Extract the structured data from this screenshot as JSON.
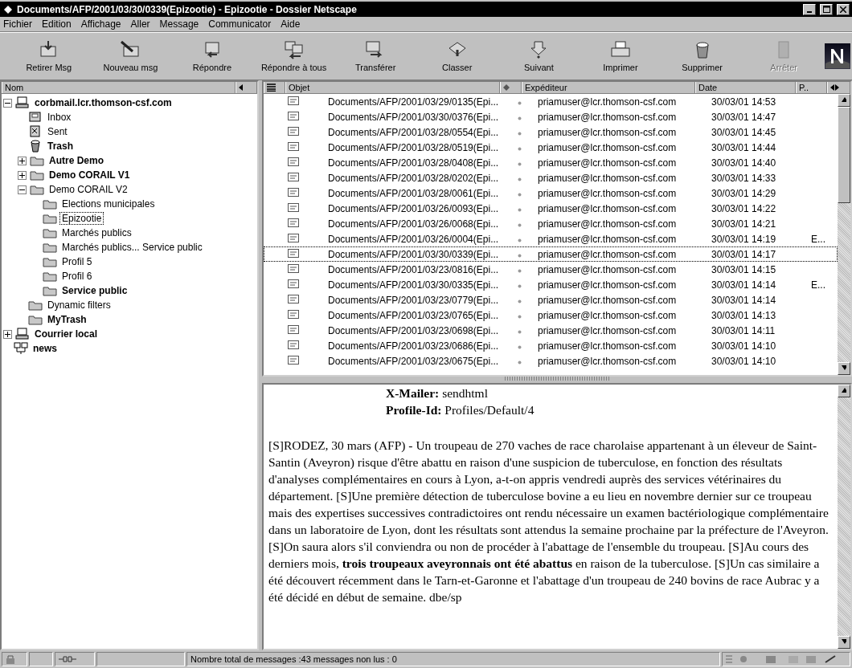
{
  "window": {
    "title": "Documents/AFP/2001/03/30/0339(Epizootie) - Epizootie - Dossier Netscape"
  },
  "menu": [
    {
      "label": "Fichier"
    },
    {
      "label": "Edition"
    },
    {
      "label": "Affichage"
    },
    {
      "label": "Aller"
    },
    {
      "label": "Message"
    },
    {
      "label": "Communicator"
    },
    {
      "label": "Aide"
    }
  ],
  "toolbar": [
    {
      "label": "Retirer Msg",
      "kind": "get",
      "disabled": false
    },
    {
      "label": "Nouveau msg",
      "kind": "new",
      "disabled": false
    },
    {
      "label": "Répondre",
      "kind": "reply",
      "disabled": false
    },
    {
      "label": "Répondre à tous",
      "kind": "replyall",
      "disabled": false
    },
    {
      "label": "Transférer",
      "kind": "forward",
      "disabled": false
    },
    {
      "label": "Classer",
      "kind": "file",
      "disabled": false
    },
    {
      "label": "Suivant",
      "kind": "next",
      "disabled": false
    },
    {
      "label": "Imprimer",
      "kind": "print",
      "disabled": false
    },
    {
      "label": "Supprimer",
      "kind": "delete",
      "disabled": false
    },
    {
      "label": "Arrêter",
      "kind": "stop",
      "disabled": true
    }
  ],
  "folder_pane": {
    "header": "Nom",
    "tree": [
      {
        "label": "corbmail.lcr.thomson-csf.com",
        "kind": "server",
        "bold": true,
        "selected": false,
        "expanded": true,
        "children": [
          {
            "label": "Inbox",
            "kind": "inbox",
            "bold": false,
            "selected": false
          },
          {
            "label": "Sent",
            "kind": "sent",
            "bold": false,
            "selected": false
          },
          {
            "label": "Trash",
            "kind": "trash",
            "bold": true,
            "selected": false
          },
          {
            "label": "Autre Demo",
            "kind": "folder",
            "bold": true,
            "selected": false,
            "expanded": false
          },
          {
            "label": "Demo CORAIL V1",
            "kind": "folder",
            "bold": true,
            "selected": false,
            "expanded": false
          },
          {
            "label": "Demo CORAIL V2",
            "kind": "folder",
            "bold": false,
            "selected": false,
            "expanded": true,
            "children": [
              {
                "label": "Elections municipales",
                "kind": "folder",
                "bold": false,
                "selected": false
              },
              {
                "label": "Epizootie",
                "kind": "folder",
                "bold": false,
                "selected": true
              },
              {
                "label": "Marchés publics",
                "kind": "folder",
                "bold": false,
                "selected": false
              },
              {
                "label": "Marchés publics... Service public",
                "kind": "folder",
                "bold": false,
                "selected": false
              },
              {
                "label": "Profil 5",
                "kind": "folder",
                "bold": false,
                "selected": false
              },
              {
                "label": "Profil 6",
                "kind": "folder",
                "bold": false,
                "selected": false
              },
              {
                "label": "Service public",
                "kind": "folder",
                "bold": true,
                "selected": false
              }
            ]
          },
          {
            "label": "Dynamic filters",
            "kind": "folder",
            "bold": false,
            "selected": false
          },
          {
            "label": "MyTrash",
            "kind": "folder",
            "bold": true,
            "selected": false
          }
        ]
      },
      {
        "label": "Courrier local",
        "kind": "server",
        "bold": true,
        "selected": false,
        "expanded": false
      },
      {
        "label": "news",
        "kind": "news",
        "bold": true,
        "selected": false
      }
    ]
  },
  "message_list": {
    "columns": [
      "Objet",
      "Expéditeur",
      "Date",
      "P.."
    ],
    "rows": [
      {
        "subject": "Documents/AFP/2001/03/29/0135(Epi...",
        "sender": "priamuser@lcr.thomson-csf.com",
        "date": "30/03/01 14:53",
        "selected": false
      },
      {
        "subject": "Documents/AFP/2001/03/30/0376(Epi...",
        "sender": "priamuser@lcr.thomson-csf.com",
        "date": "30/03/01 14:47",
        "selected": false
      },
      {
        "subject": "Documents/AFP/2001/03/28/0554(Epi...",
        "sender": "priamuser@lcr.thomson-csf.com",
        "date": "30/03/01 14:45",
        "selected": false
      },
      {
        "subject": "Documents/AFP/2001/03/28/0519(Epi...",
        "sender": "priamuser@lcr.thomson-csf.com",
        "date": "30/03/01 14:44",
        "selected": false
      },
      {
        "subject": "Documents/AFP/2001/03/28/0408(Epi...",
        "sender": "priamuser@lcr.thomson-csf.com",
        "date": "30/03/01 14:40",
        "selected": false
      },
      {
        "subject": "Documents/AFP/2001/03/28/0202(Epi...",
        "sender": "priamuser@lcr.thomson-csf.com",
        "date": "30/03/01 14:33",
        "selected": false
      },
      {
        "subject": "Documents/AFP/2001/03/28/0061(Epi...",
        "sender": "priamuser@lcr.thomson-csf.com",
        "date": "30/03/01 14:29",
        "selected": false
      },
      {
        "subject": "Documents/AFP/2001/03/26/0093(Epi...",
        "sender": "priamuser@lcr.thomson-csf.com",
        "date": "30/03/01 14:22",
        "selected": false
      },
      {
        "subject": "Documents/AFP/2001/03/26/0068(Epi...",
        "sender": "priamuser@lcr.thomson-csf.com",
        "date": "30/03/01 14:21",
        "selected": false
      },
      {
        "subject": "Documents/AFP/2001/03/26/0004(Epi...",
        "sender": "priamuser@lcr.thomson-csf.com",
        "date": "30/03/01 14:19",
        "column_5": "E...",
        "selected": false
      },
      {
        "subject": "Documents/AFP/2001/03/30/0339(Epi...",
        "sender": "priamuser@lcr.thomson-csf.com",
        "date": "30/03/01 14:17",
        "selected": true
      },
      {
        "subject": "Documents/AFP/2001/03/23/0816(Epi...",
        "sender": "priamuser@lcr.thomson-csf.com",
        "date": "30/03/01 14:15",
        "selected": false
      },
      {
        "subject": "Documents/AFP/2001/03/30/0335(Epi...",
        "sender": "priamuser@lcr.thomson-csf.com",
        "date": "30/03/01 14:14",
        "column_5": "E...",
        "selected": false
      },
      {
        "subject": "Documents/AFP/2001/03/23/0779(Epi...",
        "sender": "priamuser@lcr.thomson-csf.com",
        "date": "30/03/01 14:14",
        "selected": false
      },
      {
        "subject": "Documents/AFP/2001/03/23/0765(Epi...",
        "sender": "priamuser@lcr.thomson-csf.com",
        "date": "30/03/01 14:13",
        "selected": false
      },
      {
        "subject": "Documents/AFP/2001/03/23/0698(Epi...",
        "sender": "priamuser@lcr.thomson-csf.com",
        "date": "30/03/01 14:11",
        "selected": false
      },
      {
        "subject": "Documents/AFP/2001/03/23/0686(Epi...",
        "sender": "priamuser@lcr.thomson-csf.com",
        "date": "30/03/01 14:10",
        "selected": false
      },
      {
        "subject": "Documents/AFP/2001/03/23/0675(Epi...",
        "sender": "priamuser@lcr.thomson-csf.com",
        "date": "30/03/01 14:10",
        "selected": false
      }
    ]
  },
  "preview": {
    "headers": [
      "**X-Mailer:** sendhtml",
      "**Profile-Id:** Profiles/Default/4"
    ],
    "body": "[S]RODEZ, 30 mars (AFP) - Un troupeau de 270 vaches de race charolaise appartenant à un éleveur de Saint-Santin (Aveyron) risque d'être abattu en raison d'une suspicion de tuberculose, en fonction des résultats d'analyses complémentaires en cours à Lyon, a-t-on appris vendredi auprès des services vétérinaires du département. [S]Une première détection de tuberculose bovine a eu lieu en novembre dernier sur ce troupeau mais des expertises successives contradictoires ont rendu nécessaire un examen bactériologique complémentaire dans un laboratoire de Lyon, dont les résultats sont attendus la semaine prochaine par la préfecture de l'Aveyron. [S]On saura alors s'il conviendra ou non de procéder à l'abattage de l'ensemble du troupeau. [S]Au cours des derniers mois, **trois troupeaux aveyronnais ont été abattus** en raison de la tuberculose. [S]Un cas similaire a été découvert récemment dans le Tarn-et-Garonne et l'abattage d'un troupeau de 240 bovins de race Aubrac y a été décidé en début de semaine. dbe/sp"
  },
  "status_bar": {
    "text": "Nombre total de messages :43 messages non lus : 0"
  }
}
